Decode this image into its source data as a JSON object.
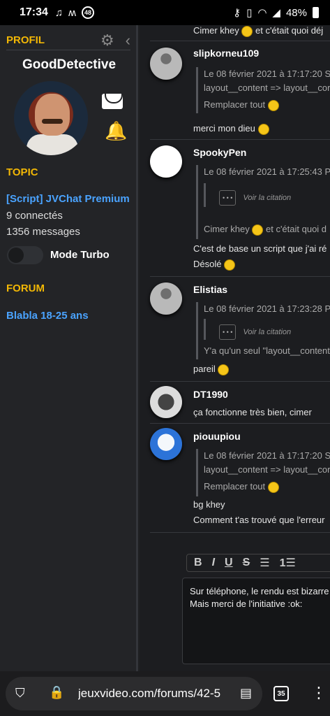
{
  "status": {
    "time": "17:34",
    "battery": "48%",
    "left_badge": "48"
  },
  "sidebar": {
    "profil_title": "PROFIL",
    "username": "GoodDetective",
    "topic_title": "TOPIC",
    "topic_name": "[Script] JVChat Premium",
    "connected": "9 connectés",
    "messages": "1356 messages",
    "turbo_label": "Mode Turbo",
    "forum_title": "FORUM",
    "forum_name": "Blabla 18-25 ans"
  },
  "top_line": "Cimer khey",
  "top_line_rest": " et c'était quoi déj",
  "messages": [
    {
      "author": "slipkorneu109",
      "quote_header": "Le 08 février 2021 à 17:17:20 S",
      "quote_line1": "layout__content => layout__cor",
      "quote_line2": "Remplacer tout",
      "body": "merci mon dieu"
    },
    {
      "author": "SpookyPen",
      "quote_header": "Le 08 février 2021 à 17:25:43 P",
      "voir": "Voir la citation",
      "quote_line2": "Cimer khey",
      "quote_line2_rest": " et c'était quoi d",
      "body1": "C'est de base un script que j'ai ré",
      "body2": "Désolé"
    },
    {
      "author": "Elistias",
      "quote_header": "Le 08 février 2021 à 17:23:28 P",
      "voir": "Voir la citation",
      "quote_line2": "Y'a qu'un seul \"layout__content",
      "body": "pareil"
    },
    {
      "author": "DT1990",
      "body": "ça fonctionne très bien, cimer"
    },
    {
      "author": "piouupiou",
      "quote_header": "Le 08 février 2021 à 17:17:20 S",
      "quote_line1": "layout__content => layout__cor",
      "quote_line2": "Remplacer tout",
      "body1": "bg khey",
      "body2": "Comment t'as trouvé que l'erreur"
    }
  ],
  "dots": "• • •",
  "toolbar": {
    "bold": "B",
    "italic": "I",
    "underline": "U",
    "strike": "S",
    "list": "☰",
    "numlist": "1☰"
  },
  "editor": {
    "line1": "Sur téléphone, le rendu est bizarre",
    "line2": "Mais merci de l'initiative :ok:"
  },
  "browser": {
    "url": "jeuxvideo.com/forums/42-5",
    "tabs": "35"
  },
  "icons": [
    "gear-icon",
    "chevron-left-icon",
    "mail-icon",
    "bell-icon",
    "shield-icon",
    "lock-icon",
    "reader-icon",
    "menu-icon"
  ]
}
